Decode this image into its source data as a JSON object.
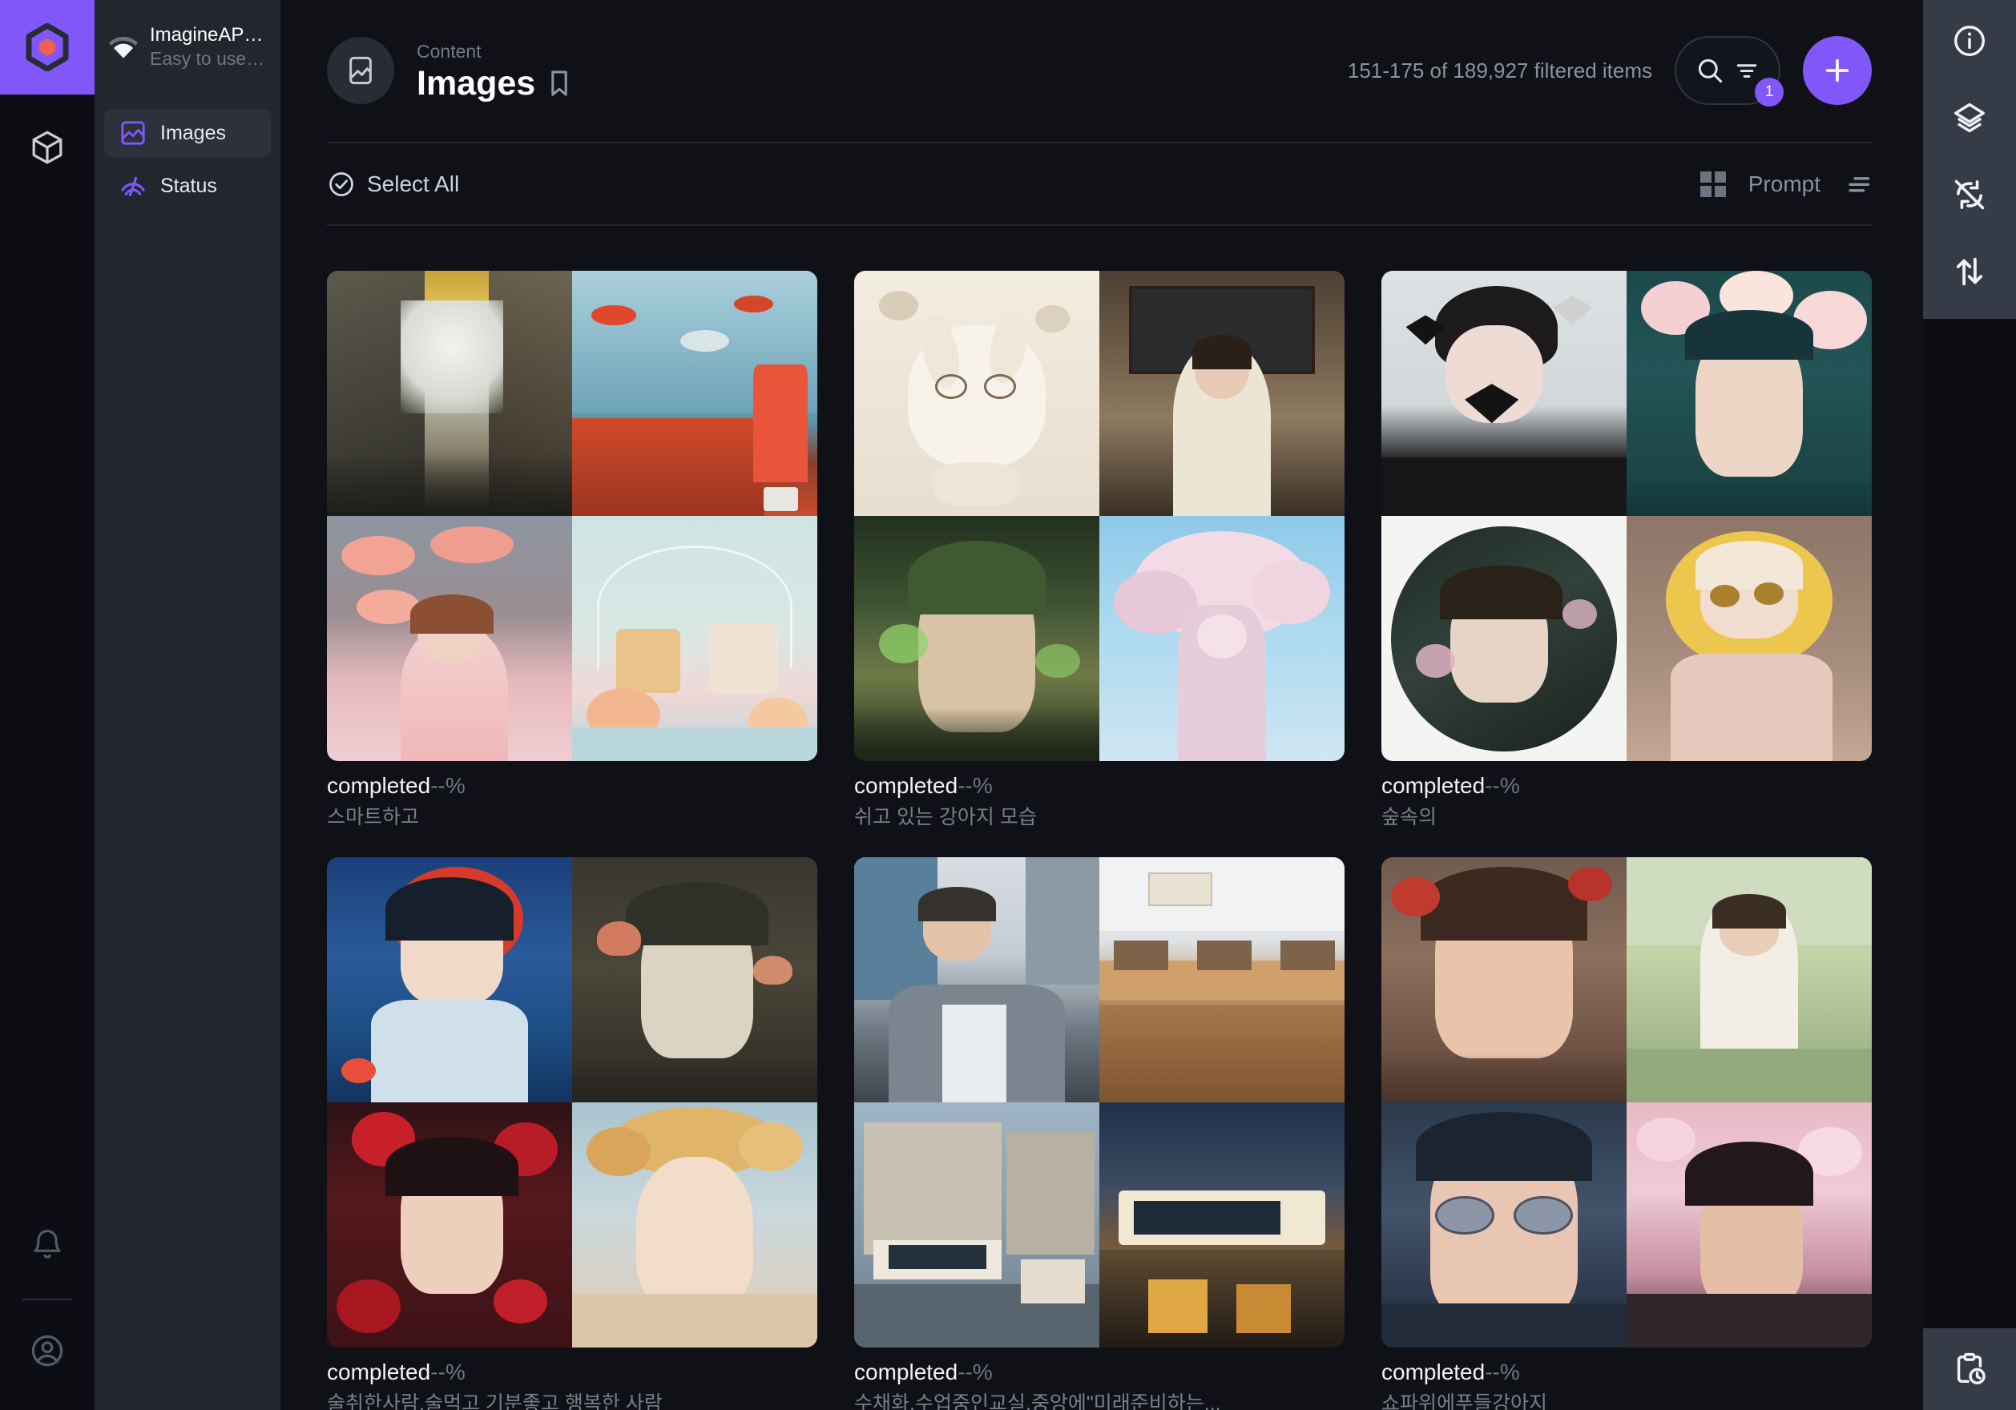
{
  "brand": {
    "logo_icon": "hexagon-logo-icon",
    "name": "ImagineAPI.dev",
    "tagline": "Easy to use Midjourne..."
  },
  "rail": {
    "items": [
      {
        "name": "workspace",
        "icon": "cube-icon"
      }
    ],
    "bottom": [
      {
        "name": "notifications",
        "icon": "bell-icon"
      },
      {
        "name": "account",
        "icon": "user-circle-icon"
      }
    ]
  },
  "sidebar": {
    "items": [
      {
        "label": "Images",
        "icon": "image-icon",
        "active": true
      },
      {
        "label": "Status",
        "icon": "activity-icon",
        "active": false
      }
    ]
  },
  "header": {
    "eyebrow": "Content",
    "title": "Images",
    "title_icon": "image-icon",
    "bookmark_icon": "bookmark-icon",
    "count_text": "151-175 of 189,927 filtered items",
    "search_icon": "search-icon",
    "filter_icon": "filter-icon",
    "filter_badge": "1",
    "add_icon": "plus-icon"
  },
  "actionbar": {
    "select_all_label": "Select All",
    "select_all_icon": "check-circle-icon",
    "grid_view_icon": "grid-view-icon",
    "sort_label": "Prompt",
    "sort_icon": "sort-descending-icon"
  },
  "right_rail": {
    "items": [
      {
        "name": "info",
        "icon": "info-circle-icon"
      },
      {
        "name": "layers",
        "icon": "layers-icon"
      },
      {
        "name": "sync-disabled",
        "icon": "sync-disabled-icon"
      },
      {
        "name": "transfer",
        "icon": "arrows-up-down-icon"
      }
    ],
    "bottom": {
      "name": "pending-tasks",
      "icon": "clipboard-clock-icon"
    }
  },
  "colors": {
    "accent": "#8257fa",
    "brand_logo_inner": "#f0604d",
    "sidebar_bg": "#22262f",
    "main_bg": "#0f1117",
    "rail_bg": "#0c0e14",
    "right_rail_panel": "#353b47",
    "text_primary": "#ffffff",
    "text_muted": "#787e8b"
  },
  "cards": [
    {
      "status": "completed",
      "percent": "--%",
      "prompt": "스마트하고"
    },
    {
      "status": "completed",
      "percent": "--%",
      "prompt": "쉬고 있는 강아지 모습"
    },
    {
      "status": "completed",
      "percent": "--%",
      "prompt": "숲속의"
    },
    {
      "status": "completed",
      "percent": "--%",
      "prompt": "술취한사람,술먹고 기분좋고 행복한 사람"
    },
    {
      "status": "completed",
      "percent": "--%",
      "prompt": "수채화,수업중인교실,중앙에\"미래준비하는..."
    },
    {
      "status": "completed",
      "percent": "--%",
      "prompt": "쇼파위에푸들강아지"
    }
  ]
}
